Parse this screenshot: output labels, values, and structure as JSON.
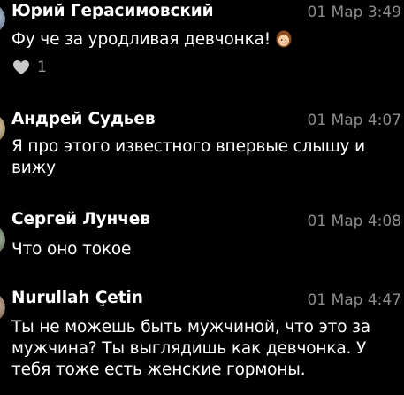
{
  "comments": [
    {
      "author": "Юрий Герасимовский",
      "time": "01 Мар 3:49",
      "text": "Фу че за уродливая девчонка!",
      "emoji_icon": "girl-face-emoji",
      "likes": "1"
    },
    {
      "author": "Андрей Судьев",
      "time": "01 Мар 4:07",
      "text": "Я про этого известного впервые слышу и вижу"
    },
    {
      "author": "Сергей Лунчев",
      "time": "01 Мар 4:08",
      "text": "Что оно токое"
    },
    {
      "author": "Nurullah Çetin",
      "time": "01 Мар 4:47",
      "text": "Ты не можешь быть мужчиной, что это за мужчина? Ты выглядишь как девчонка. У тебя тоже есть женские гормоны."
    }
  ],
  "colors": {
    "background": "#000000",
    "author": "#ffffff",
    "time": "#8c8c8c",
    "heart": "#c8c8c8"
  }
}
